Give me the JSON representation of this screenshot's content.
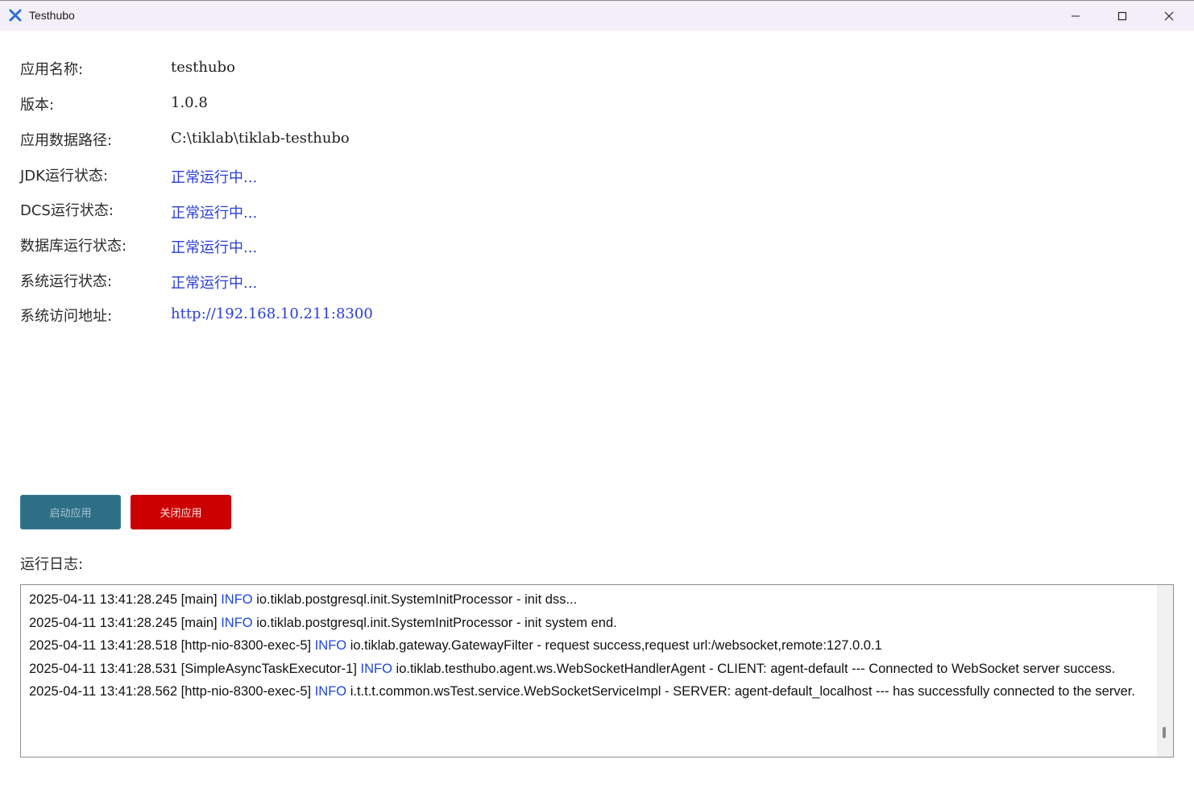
{
  "window": {
    "title": "Testhubo",
    "icon": "testhubo-logo-icon",
    "controls": [
      "minimize-icon",
      "maximize-icon",
      "close-icon"
    ]
  },
  "info": {
    "app_name_label": "应用名称:",
    "app_name_value": "testhubo",
    "version_label": "版本:",
    "version_value": "1.0.8",
    "data_path_label": "应用数据路径:",
    "data_path_value": "C:\\tiklab\\tiklab-testhubo",
    "jdk_label": "JDK运行状态:",
    "jdk_value": "正常运行中...",
    "dcs_label": "DCS运行状态:",
    "dcs_value": "正常运行中...",
    "db_label": "数据库运行状态:",
    "db_value": "正常运行中...",
    "system_label": "系统运行状态:",
    "system_value": "正常运行中...",
    "url_label": "系统访问地址:",
    "url_value": "http://192.168.10.211:8300"
  },
  "buttons": {
    "start_label": "启动应用",
    "stop_label": "关闭应用"
  },
  "log": {
    "label": "运行日志:",
    "lines": [
      {
        "prefix": "2025-04-11 13:41:28.245 [main]",
        "level": "INFO",
        "message": "io.tiklab.postgresql.init.SystemInitProcessor - init dss..."
      },
      {
        "prefix": "2025-04-11 13:41:28.245 [main]",
        "level": "INFO",
        "message": "io.tiklab.postgresql.init.SystemInitProcessor - init system end."
      },
      {
        "prefix": "2025-04-11 13:41:28.518 [http-nio-8300-exec-5]",
        "level": "INFO",
        "message": "io.tiklab.gateway.GatewayFilter - request success,request url:/websocket,remote:127.0.0.1"
      },
      {
        "prefix": "2025-04-11 13:41:28.531 [SimpleAsyncTaskExecutor-1]",
        "level": "INFO",
        "message": "io.tiklab.testhubo.agent.ws.WebSocketHandlerAgent - CLIENT:  agent-default --- Connected to WebSocket server success."
      },
      {
        "prefix": "2025-04-11 13:41:28.562 [http-nio-8300-exec-5]",
        "level": "INFO",
        "message": "i.t.t.t.common.wsTest.service.WebSocketServiceImpl - SERVER:  agent-default_localhost --- has successfully connected to the server."
      }
    ]
  },
  "colors": {
    "status_blue": "#2a3fd6",
    "start_button": "#2f6f86",
    "stop_button": "#cc0000",
    "log_level": "#1f47d9"
  }
}
